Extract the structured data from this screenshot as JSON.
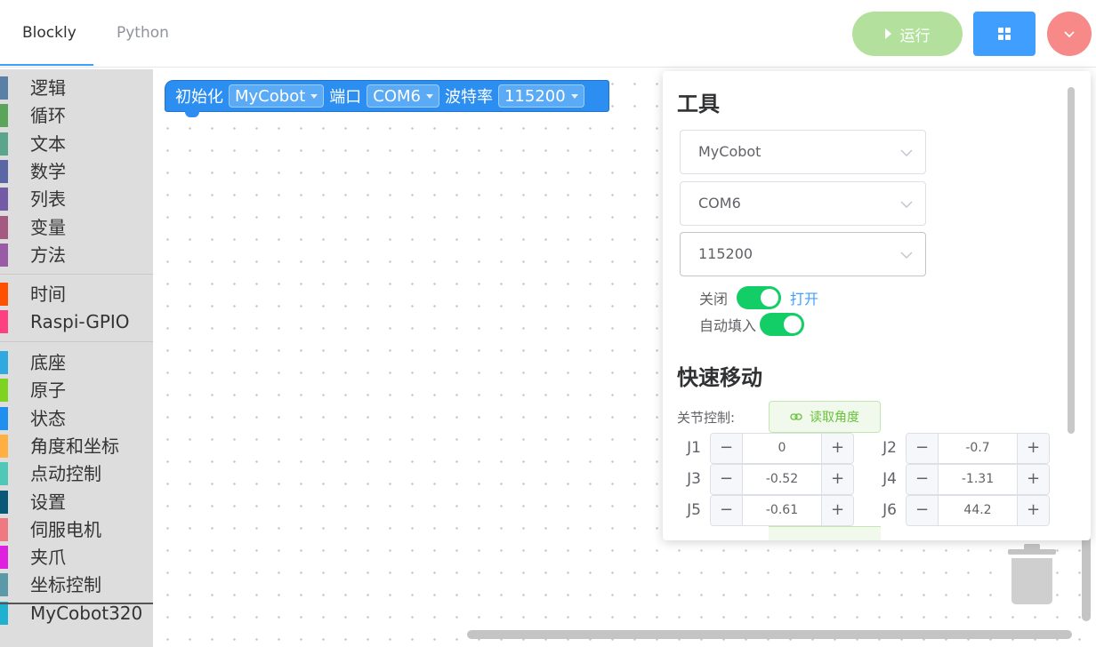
{
  "header": {
    "tabs": [
      {
        "label": "Blockly",
        "active": true
      },
      {
        "label": "Python",
        "active": false
      }
    ],
    "run_label": "运行",
    "run_color": "#b3e19d",
    "grid_color": "#409eff",
    "menu_color": "#f78989"
  },
  "toolbox": {
    "groups": [
      [
        {
          "label": "逻辑",
          "color": "#5b80a5"
        },
        {
          "label": "循环",
          "color": "#5ba55b"
        },
        {
          "label": "文本",
          "color": "#5ba58c"
        },
        {
          "label": "数学",
          "color": "#5b67a5"
        },
        {
          "label": "列表",
          "color": "#745ba5"
        },
        {
          "label": "变量",
          "color": "#a55b80"
        },
        {
          "label": "方法",
          "color": "#995ba5"
        }
      ],
      [
        {
          "label": "时间",
          "color": "#ff5000"
        },
        {
          "label": "Raspi-GPIO",
          "color": "#ff4080"
        }
      ],
      [
        {
          "label": "底座",
          "color": "#30a8e0"
        },
        {
          "label": "原子",
          "color": "#7ed321"
        },
        {
          "label": "状态",
          "color": "#2090f0"
        },
        {
          "label": "角度和坐标",
          "color": "#ffb040"
        },
        {
          "label": "点动控制",
          "color": "#50c8b8"
        },
        {
          "label": "设置",
          "color": "#0a5878"
        },
        {
          "label": "伺服电机",
          "color": "#f07880"
        },
        {
          "label": "夹爪",
          "color": "#e020e0"
        },
        {
          "label": "坐标控制",
          "color": "#5a9aa8"
        }
      ],
      [
        {
          "label": "MyCobot320",
          "color": "#20b0d0"
        }
      ]
    ]
  },
  "block": {
    "label_init": "初始化",
    "device": "MyCobot",
    "label_port": "端口",
    "port": "COM6",
    "label_baud": "波特率",
    "baud": "115200",
    "color": "#2c8ef0"
  },
  "panel": {
    "title": "工具",
    "device_select": "MyCobot",
    "port_select": "COM6",
    "baud_select": "115200",
    "toggle_off_label": "关闭",
    "toggle_on_label": "打开",
    "autofill_label": "自动填入",
    "quick_title": "快速移动",
    "joint_control_label": "关节控制:",
    "read_angles_label": "读取角度",
    "joints": [
      {
        "label": "J1",
        "value": "0"
      },
      {
        "label": "J2",
        "value": "-0.7"
      },
      {
        "label": "J3",
        "value": "-0.52"
      },
      {
        "label": "J4",
        "value": "-1.31"
      },
      {
        "label": "J5",
        "value": "-0.61"
      },
      {
        "label": "J6",
        "value": "44.2"
      }
    ],
    "minus_symbol": "−",
    "plus_symbol": "+"
  }
}
